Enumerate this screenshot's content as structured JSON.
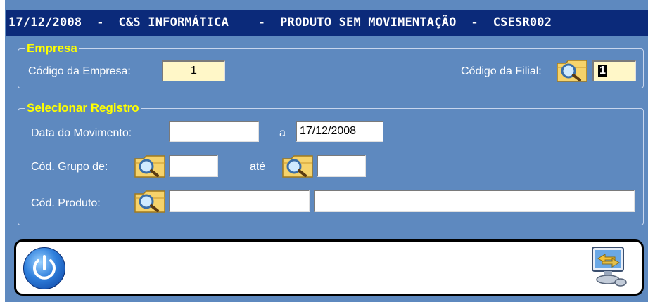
{
  "window": {
    "title": "17/12/2008  -  C&S INFORMÁTICA    -  PRODUTO SEM MOVIMENTAÇÃO  -  CSESR002"
  },
  "empresa": {
    "legend": "Empresa",
    "codigo_empresa_label": "Código da Empresa:",
    "codigo_empresa_value": "1",
    "codigo_filial_label": "Código da Filial:",
    "codigo_filial_value": "1"
  },
  "selecionar": {
    "legend": "Selecionar Registro",
    "data_movimento_label": "Data do Movimento:",
    "data_movimento_from": "",
    "a_label": "a",
    "data_movimento_to": "17/12/2008",
    "grupo_label": "Cód. Grupo de:",
    "grupo_from": "",
    "ate_label": "até",
    "grupo_to": "",
    "produto_label": "Cód. Produto:",
    "produto_code": "",
    "produto_desc": ""
  },
  "icons": {
    "lookup": "folder-magnifier-icon",
    "power": "power-icon",
    "exit": "monitor-exchange-icon"
  },
  "colors": {
    "window_bg": "#5e89bf",
    "titlebar_bg": "#0b2a7a",
    "legend_text": "#ffff00"
  }
}
